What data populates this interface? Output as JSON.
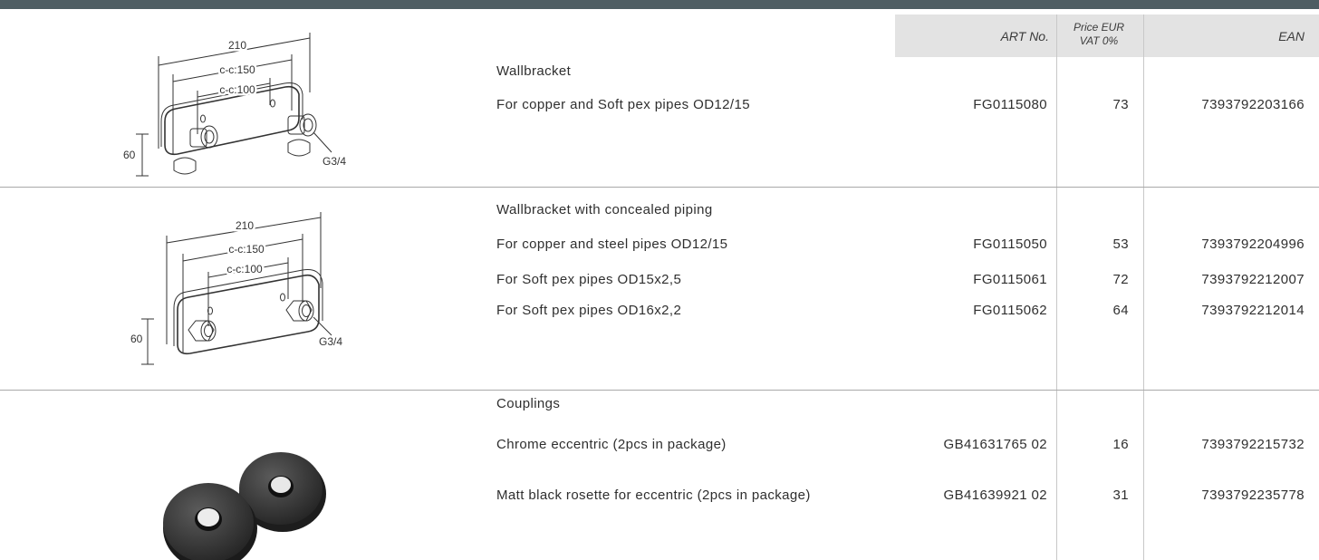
{
  "colors": {
    "top_bar": "#4e5d63",
    "header_bg": "#e3e3e3",
    "rule": "#a9a9a9"
  },
  "header": {
    "art_no": "ART No.",
    "price_line1": "Price EUR",
    "price_line2": "VAT 0%",
    "ean": "EAN"
  },
  "sections": [
    {
      "title": "Wallbracket",
      "drawing": {
        "overall": "210",
        "cc_outer": "c-c:150",
        "cc_inner": "c-c:100",
        "height": "60",
        "thread": "G3/4"
      },
      "rows": [
        {
          "desc": "For copper and Soft pex pipes OD12/15",
          "art": "FG0115080",
          "price": "73",
          "ean": "7393792203166"
        }
      ]
    },
    {
      "title": "Wallbracket with concealed piping",
      "drawing": {
        "overall": "210",
        "cc_outer": "c-c:150",
        "cc_inner": "c-c:100",
        "height": "60",
        "thread": "G3/4"
      },
      "rows": [
        {
          "desc": "For copper and steel pipes OD12/15",
          "art": "FG0115050",
          "price": "53",
          "ean": "7393792204996"
        },
        {
          "desc": "For Soft pex pipes OD15x2,5",
          "art": "FG0115061",
          "price": "72",
          "ean": "7393792212007"
        },
        {
          "desc": "For Soft pex pipes OD16x2,2",
          "art": "FG0115062",
          "price": "64",
          "ean": "7393792212014"
        }
      ]
    },
    {
      "title": "Couplings",
      "rows": [
        {
          "desc": "Chrome eccentric (2pcs in package)",
          "art": "GB41631765 02",
          "price": "16",
          "ean": "7393792215732"
        },
        {
          "desc": "Matt black rosette for eccentric (2pcs in package)",
          "art": "GB41639921 02",
          "price": "31",
          "ean": "7393792235778"
        }
      ]
    }
  ]
}
